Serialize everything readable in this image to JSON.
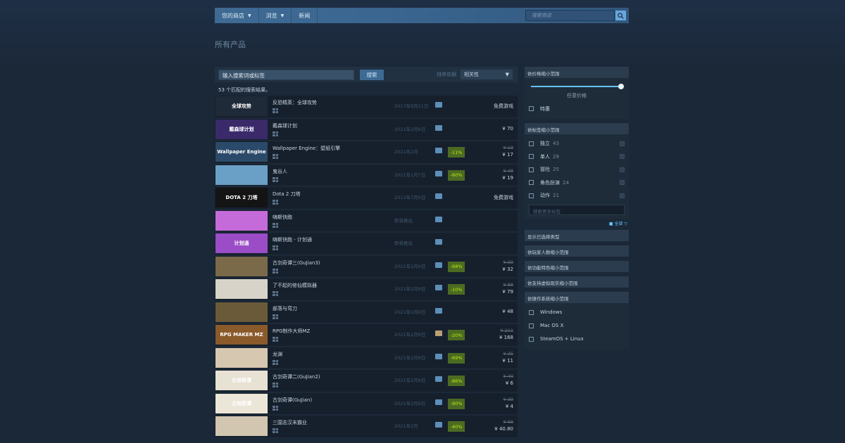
{
  "nav": {
    "items": [
      {
        "label": "您的商店",
        "caret": true
      },
      {
        "label": "浏览",
        "caret": true
      },
      {
        "label": "新闻",
        "caret": false
      }
    ],
    "search_placeholder": "搜索商店"
  },
  "page_title": "所有产品",
  "search": {
    "term": "输入搜索词或标签",
    "button": "搜索",
    "sort_label": "排序依据",
    "sort_value": "相关性",
    "result_count": "53 个匹配的搜索结果。"
  },
  "results": [
    {
      "name": "反恐精英：全球攻势",
      "date": "2017年8月21日",
      "review": "positive",
      "discount": "",
      "original": "",
      "price": "免费游戏",
      "thumb_bg": "#1f2a38",
      "thumb_text": "全球攻势"
    },
    {
      "name": "戴森球计划",
      "date": "2021年2月6日",
      "review": "positive",
      "discount": "",
      "original": "",
      "price": "¥ 70",
      "thumb_bg": "#3a2a6a",
      "thumb_text": "戴森球计划"
    },
    {
      "name": "Wallpaper Engine：壁纸引擎",
      "date": "2021年2月",
      "review": "positive",
      "discount": "-11%",
      "original": "¥ 19",
      "price": "¥ 17",
      "thumb_bg": "#2b4a6a",
      "thumb_text": "Wallpaper Engine"
    },
    {
      "name": "鬼谷人",
      "date": "2021年1月7日",
      "review": "positive",
      "discount": "-60%",
      "original": "¥ 48",
      "price": "¥ 19",
      "thumb_bg": "#6aa0c6",
      "thumb_text": ""
    },
    {
      "name": "Dota 2 刀塔",
      "date": "2013年7月9日",
      "review": "positive",
      "discount": "",
      "original": "",
      "price": "免费游戏",
      "thumb_bg": "#141414",
      "thumb_text": "DOTA 2 刀塔"
    },
    {
      "name": "嗨斯快跑",
      "date": "即将推出",
      "review": "positive",
      "discount": "",
      "original": "",
      "price": "",
      "thumb_bg": "#c56bd9",
      "thumb_text": ""
    },
    {
      "name": "嗨斯快跑 - 计划通",
      "date": "即将推出",
      "review": "positive",
      "discount": "",
      "original": "",
      "price": "",
      "thumb_bg": "#9a4dc7",
      "thumb_text": "计划通"
    },
    {
      "name": "古剑奇谭三(GuJian3)",
      "date": "2021年2月8日",
      "review": "positive",
      "discount": "-68%",
      "original": "¥ 99",
      "price": "¥ 32",
      "thumb_bg": "#7a6a4a",
      "thumb_text": ""
    },
    {
      "name": "了不起的修仙模拟器",
      "date": "2021年2月8日",
      "review": "positive",
      "discount": "-10%",
      "original": "¥ 88",
      "price": "¥ 79",
      "thumb_bg": "#d8d3c8",
      "thumb_text": ""
    },
    {
      "name": "部落与弯刀",
      "date": "2021年2月8日",
      "review": "positive",
      "discount": "",
      "original": "",
      "price": "¥ 48",
      "thumb_bg": "#6b5a3a",
      "thumb_text": ""
    },
    {
      "name": "RPG制作大师MZ",
      "date": "2021年2月8日",
      "review": "mixed",
      "discount": "-20%",
      "original": "¥ 211",
      "price": "¥ 168",
      "thumb_bg": "#8a5a2a",
      "thumb_text": "RPG MAKER MZ"
    },
    {
      "name": "龙渊",
      "date": "2021年2月8日",
      "review": "positive",
      "discount": "-69%",
      "original": "¥ 35",
      "price": "¥ 11",
      "thumb_bg": "#d6c8b0",
      "thumb_text": ""
    },
    {
      "name": "古剑奇谭二(GuJian2)",
      "date": "2021年2月8日",
      "review": "positive",
      "discount": "-86%",
      "original": "¥ 49",
      "price": "¥ 6",
      "thumb_bg": "#e8e2d4",
      "thumb_text": "古剑奇谭"
    },
    {
      "name": "古剑奇谭(GuJian)",
      "date": "2021年2月8日",
      "review": "positive",
      "discount": "-90%",
      "original": "¥ 39",
      "price": "¥ 4",
      "thumb_bg": "#ece6d8",
      "thumb_text": "古剑奇谭"
    },
    {
      "name": "三国志汉末霸业",
      "date": "2021年2月",
      "review": "positive",
      "discount": "-40%",
      "original": "¥ 68",
      "price": "¥ 40.80",
      "thumb_bg": "#d2c6b0",
      "thumb_text": ""
    }
  ],
  "filters": {
    "price": {
      "title": "依价格缩小范围",
      "value_label": "任意价格",
      "special": "特惠"
    },
    "tags": {
      "title": "依标签缩小范围",
      "items": [
        {
          "label": "独立",
          "count": "43"
        },
        {
          "label": "单人",
          "count": "29"
        },
        {
          "label": "冒险",
          "count": "25"
        },
        {
          "label": "角色扮演",
          "count": "24"
        },
        {
          "label": "动作",
          "count": "21"
        }
      ],
      "search_placeholder": "搜索更多标签",
      "see_all": "■ 全部 ▽"
    },
    "sections": [
      "显示已选择类型",
      "依玩家人数缩小范围",
      "依功能特色缩小范围",
      "依支持虚拟现实缩小范围"
    ],
    "os": {
      "title": "依操作系统缩小范围",
      "items": [
        "Windows",
        "Mac OS X",
        "SteamOS + Linux"
      ]
    }
  },
  "colors": {
    "background": "#1b2838",
    "nav": "#3e6a93",
    "discount_bg": "#4c6b22",
    "discount_text": "#beee11",
    "accent": "#67c1f5"
  }
}
